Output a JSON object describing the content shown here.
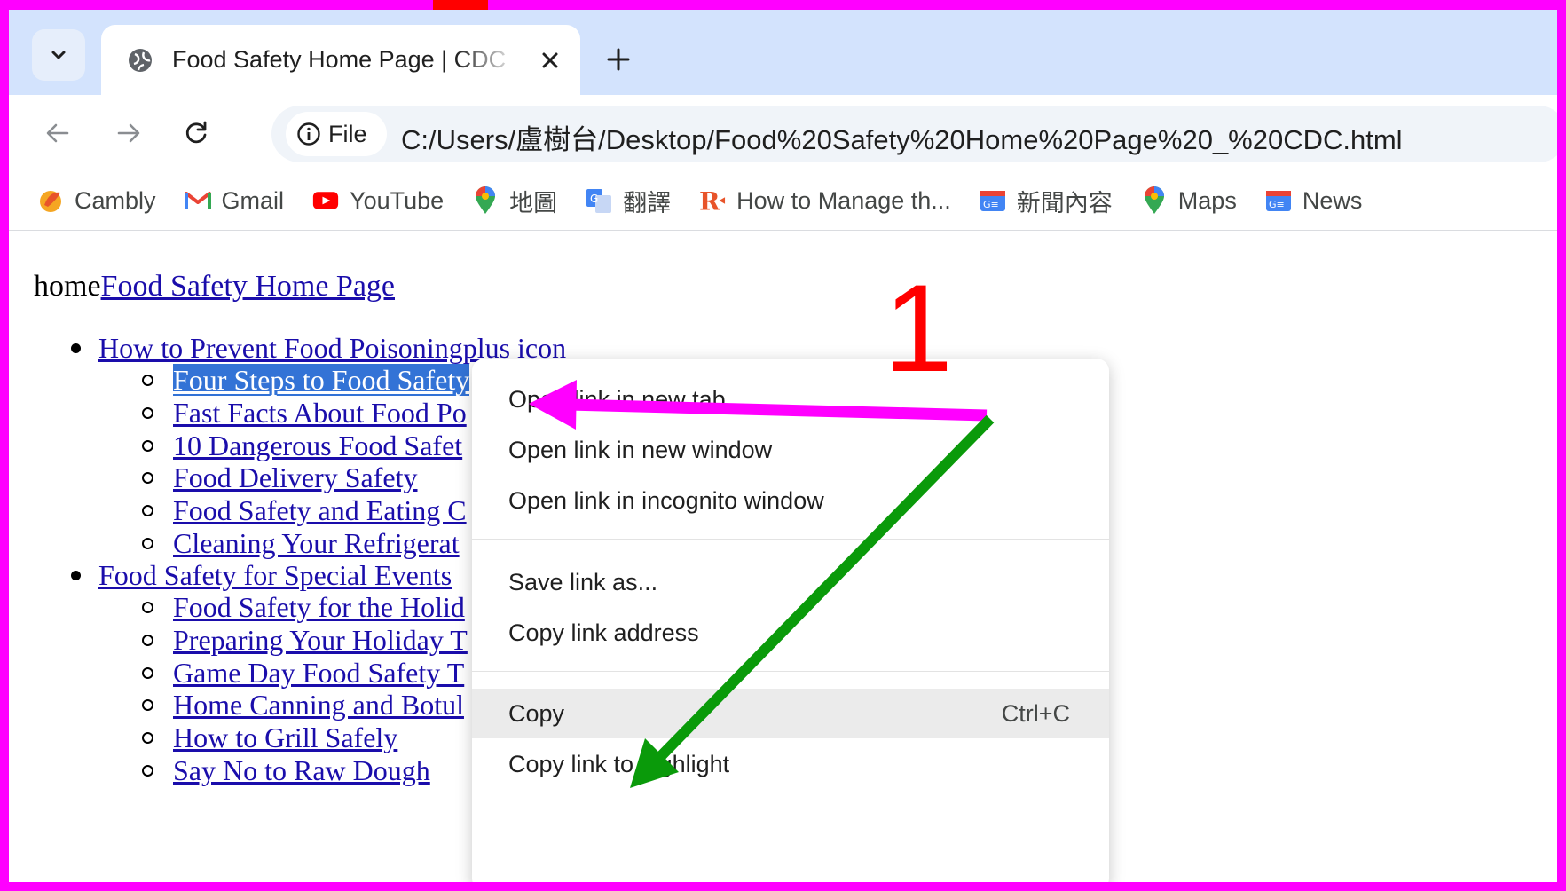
{
  "tab": {
    "title": "Food Safety Home Page | CDC"
  },
  "toolbar": {
    "chip_label": "File",
    "url": "C:/Users/盧樹台/Desktop/Food%20Safety%20Home%20Page%20_%20CDC.html"
  },
  "bookmarks": [
    {
      "label": "Cambly",
      "icon": "cambly-icon"
    },
    {
      "label": "Gmail",
      "icon": "gmail-icon"
    },
    {
      "label": "YouTube",
      "icon": "youtube-icon"
    },
    {
      "label": "地圖",
      "icon": "maps-pin-icon"
    },
    {
      "label": "翻譯",
      "icon": "translate-icon"
    },
    {
      "label": "How to Manage th...",
      "icon": "r-logo-icon"
    },
    {
      "label": "新聞內容",
      "icon": "google-news-icon"
    },
    {
      "label": "Maps",
      "icon": "maps-pin-icon"
    },
    {
      "label": "News",
      "icon": "google-news-icon"
    }
  ],
  "page": {
    "breadcrumb_prefix": "home",
    "breadcrumb_link": "Food Safety Home Page",
    "section1": "How to Prevent Food Poisoningplus icon",
    "section1_items": [
      "Four Steps to Food Safety",
      "Fast Facts About Food Po",
      "10 Dangerous Food Safet",
      "Food Delivery Safety",
      "Food Safety and Eating C",
      "Cleaning Your Refrigerat"
    ],
    "section2": "Food Safety for Special Events",
    "section2_items": [
      "Food Safety for the Holid",
      "Preparing Your Holiday T",
      "Game Day Food Safety T",
      "Home Canning and Botul",
      "How to Grill Safely",
      "Say No to Raw Dough"
    ]
  },
  "context_menu": {
    "open_new_tab": "Open link in new tab",
    "open_new_window": "Open link in new window",
    "open_incognito": "Open link in incognito window",
    "save_link": "Save link as...",
    "copy_link_address": "Copy link address",
    "copy": "Copy",
    "copy_shortcut": "Ctrl+C",
    "copy_link_highlight": "Copy link to highlight"
  },
  "annotation": {
    "step_number": "1",
    "colors": {
      "frame": "#ff00ff",
      "arrow_pink": "#ff00ff",
      "arrow_green": "#0a9a0a",
      "number": "#ff0000"
    }
  }
}
